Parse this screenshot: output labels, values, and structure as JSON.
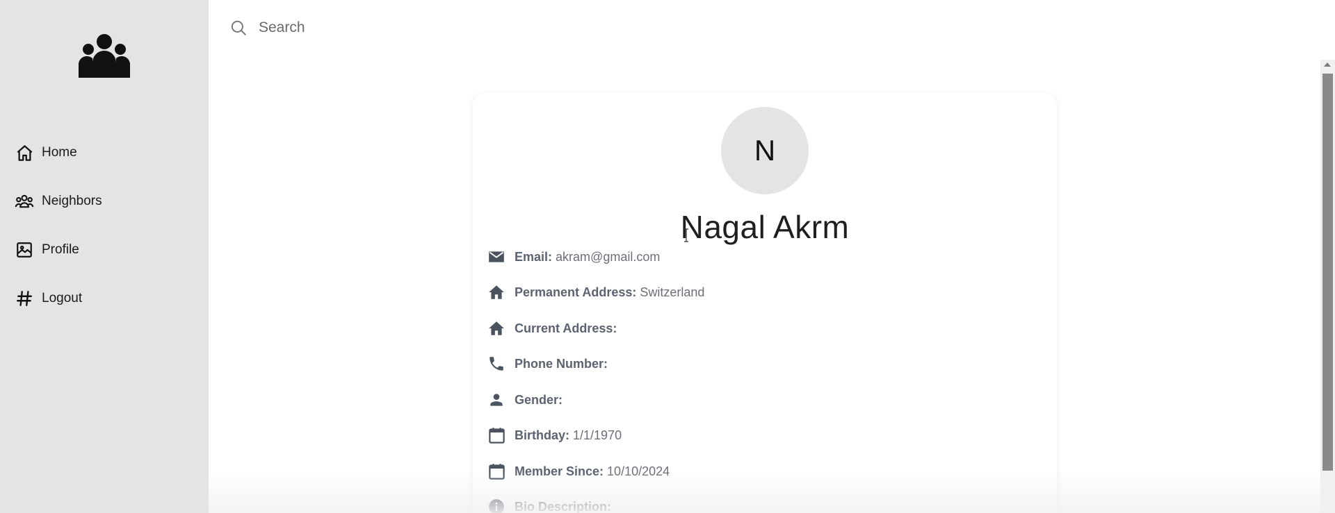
{
  "sidebar": {
    "logo_icon": "people-group-icon",
    "items": [
      {
        "label": "Home",
        "icon": "home-icon"
      },
      {
        "label": "Neighbors",
        "icon": "users-icon"
      },
      {
        "label": "Profile",
        "icon": "image-icon"
      },
      {
        "label": "Logout",
        "icon": "hash-icon"
      }
    ]
  },
  "search": {
    "placeholder": "Search",
    "icon": "search-icon"
  },
  "profile": {
    "avatar_initial": "N",
    "name": "Nagal Akrm",
    "fields": [
      {
        "label": "Email:",
        "value": "akram@gmail.com",
        "icon": "mail-icon"
      },
      {
        "label": "Permanent Address:",
        "value": "Switzerland",
        "icon": "home-filled-icon"
      },
      {
        "label": "Current Address:",
        "value": "",
        "icon": "home-filled-icon"
      },
      {
        "label": "Phone Number:",
        "value": "",
        "icon": "phone-icon"
      },
      {
        "label": "Gender:",
        "value": "",
        "icon": "person-icon"
      },
      {
        "label": "Birthday:",
        "value": "1/1/1970",
        "icon": "calendar-icon"
      },
      {
        "label": "Member Since:",
        "value": "10/10/2024",
        "icon": "calendar-icon"
      },
      {
        "label": "Bio Description:",
        "value": "",
        "icon": "info-icon"
      }
    ]
  },
  "colors": {
    "sidebar_bg": "#e4e4e4",
    "avatar_bg": "#e4e4e4",
    "label_text": "#5b6270",
    "icon_dark": "#4b5360"
  }
}
